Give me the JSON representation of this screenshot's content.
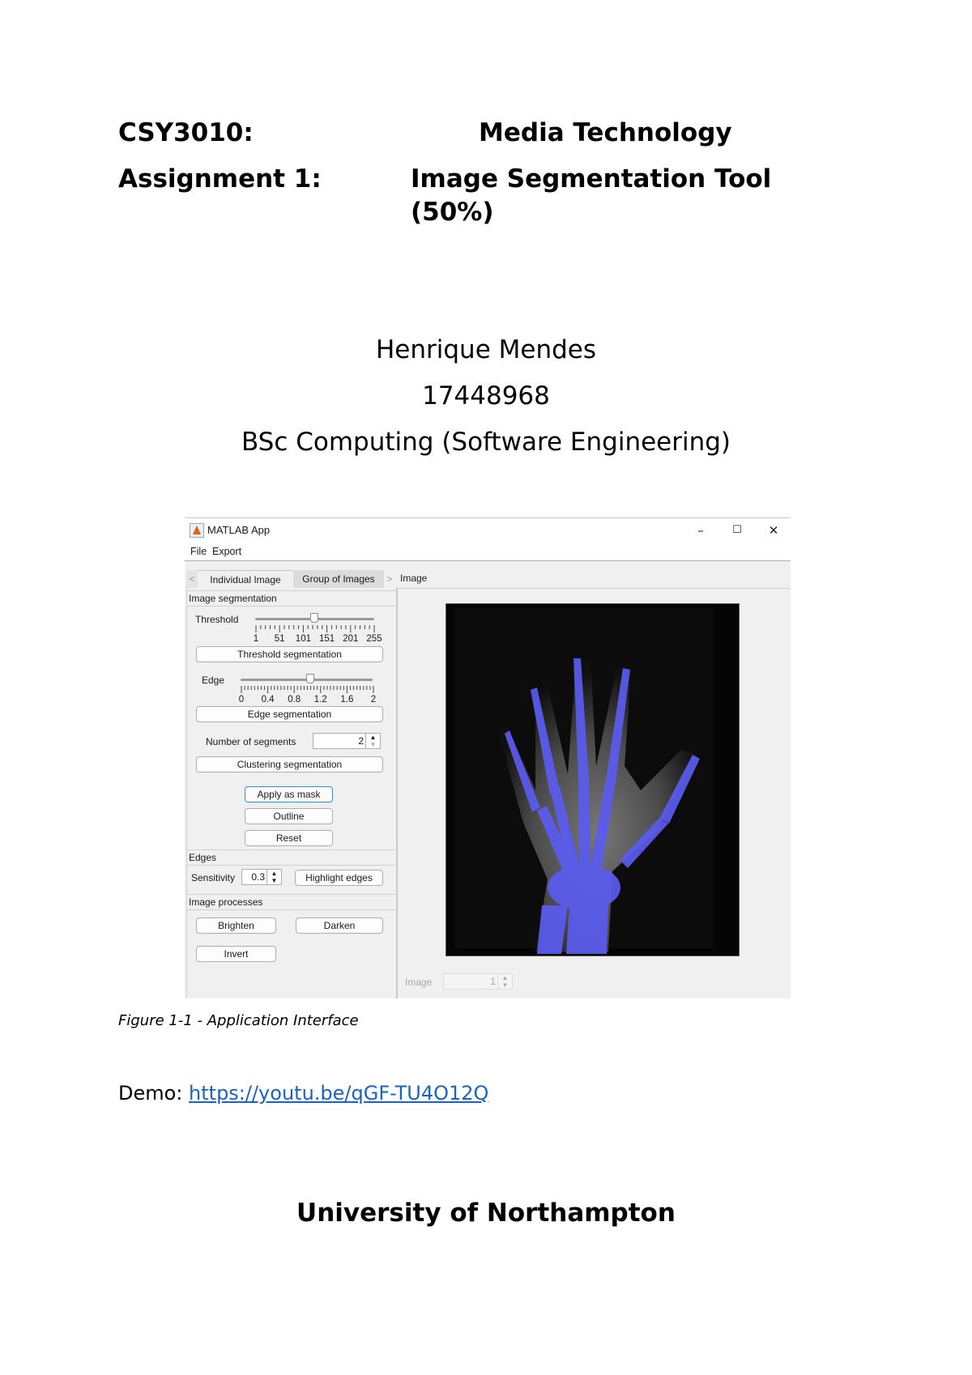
{
  "document": {
    "course_code": "CSY3010:",
    "course_name": "Media Technology",
    "assignment_label": "Assignment 1:",
    "assignment_title_line1": "Image Segmentation Tool",
    "assignment_title_line2": "(50%)",
    "author": "Henrique Mendes",
    "student_id": "17448968",
    "programme": "BSc Computing (Software Engineering)",
    "figure_caption": "Figure 1-1 - Application Interface",
    "demo_label": "Demo: ",
    "demo_link": "https://youtu.be/qGF-TU4O12Q",
    "university": "University of Northampton"
  },
  "app": {
    "title": "MATLAB App",
    "window_buttons": {
      "minimize": "–",
      "maximize": "☐",
      "close": "✕"
    },
    "menu": [
      "File",
      "Export"
    ],
    "tabs": [
      {
        "label": "Individual Image",
        "active": true
      },
      {
        "label": "Group of Images",
        "active": false
      }
    ],
    "tab_prev": "<",
    "tab_next": ">",
    "left_panel": {
      "segmentation_title": "Image segmentation",
      "threshold": {
        "label": "Threshold",
        "ticks": [
          "1",
          "51",
          "101",
          "151",
          "201",
          "255"
        ],
        "min": 1,
        "max": 255,
        "value": 128
      },
      "threshold_button": "Threshold segmentation",
      "edge": {
        "label": "Edge",
        "ticks": [
          "0",
          "0.4",
          "0.8",
          "1.2",
          "1.6",
          "2"
        ],
        "min": 0,
        "max": 2,
        "value": 1.05
      },
      "edge_button": "Edge segmentation",
      "segments_label": "Number of segments",
      "segments_value": "2",
      "clustering_button": "Clustering segmentation",
      "apply_mask_button": "Apply as mask",
      "outline_button": "Outline",
      "reset_button": "Reset",
      "edges_title": "Edges",
      "sensitivity_label": "Sensitivity",
      "sensitivity_value": "0.3",
      "highlight_button": "Highlight edges",
      "processes_title": "Image processes",
      "brighten_button": "Brighten",
      "darken_button": "Darken",
      "invert_button": "Invert"
    },
    "image_panel": {
      "title": "Image",
      "image_label": "Image",
      "image_value": "1",
      "mask_color": "#5b5cf0"
    }
  }
}
